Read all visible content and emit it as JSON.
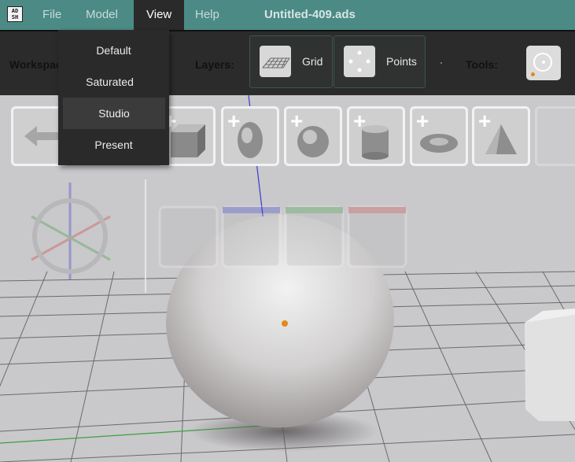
{
  "menubar": {
    "app_icon_text": "AD SH",
    "items": [
      {
        "label": "File"
      },
      {
        "label": "Model"
      },
      {
        "label": "View"
      },
      {
        "label": "Help"
      }
    ],
    "document_title": "Untitled-409.ads"
  },
  "toolbar": {
    "workspace_label": "Workspace:",
    "layers_label": "Layers:",
    "tools_label": "Tools:",
    "layers": [
      {
        "label": "Grid",
        "icon": "grid-icon"
      },
      {
        "label": "Points",
        "icon": "points-icon"
      }
    ],
    "tools_icon": "circle-tool-icon"
  },
  "view_menu": {
    "items": [
      {
        "label": "Default"
      },
      {
        "label": "Saturated"
      },
      {
        "label": "Studio",
        "highlighted": true
      },
      {
        "label": "Present"
      }
    ]
  },
  "shape_palette": {
    "back_icon": "back-arrow-icon",
    "items": [
      {
        "icon": "add-cube-icon"
      },
      {
        "icon": "add-egg-icon"
      },
      {
        "icon": "add-sphere-icon"
      },
      {
        "icon": "add-cylinder-icon"
      },
      {
        "icon": "add-torus-icon"
      },
      {
        "icon": "add-cone-icon"
      }
    ]
  },
  "colors": {
    "menubar": "#4c8a85",
    "toolbar": "#2b2b2b",
    "viewport": "#c9c8cb",
    "accent_orange": "#e08a1e",
    "axis_blue": "#3b3bd0",
    "axis_green": "#3ca03c"
  }
}
